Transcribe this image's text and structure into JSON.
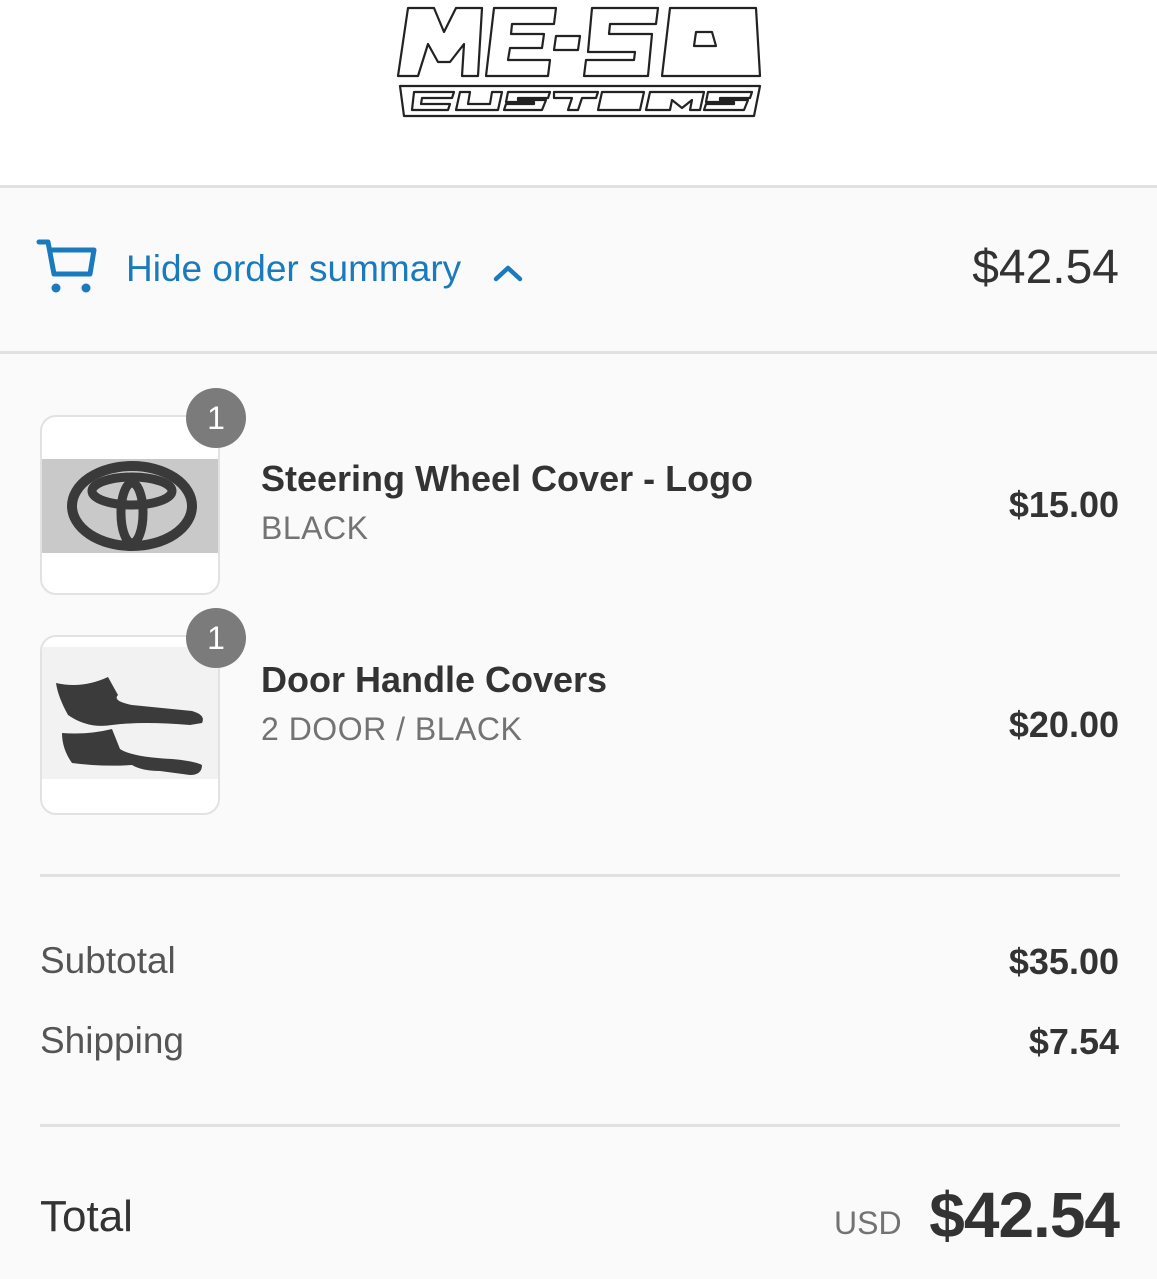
{
  "brand": {
    "logo_text_line1": "ME-SO",
    "logo_text_line2": "CUSTOMS"
  },
  "summary_toggle": {
    "label": "Hide order summary",
    "total": "$42.54",
    "accent_color": "#197bbd"
  },
  "line_items": [
    {
      "quantity": "1",
      "name": "Steering Wheel Cover - Logo",
      "variant": "BLACK",
      "price": "$15.00"
    },
    {
      "quantity": "1",
      "name": "Door Handle Covers",
      "variant": "2 DOOR / BLACK",
      "price": "$20.00"
    }
  ],
  "costs": {
    "subtotal_label": "Subtotal",
    "subtotal_value": "$35.00",
    "shipping_label": "Shipping",
    "shipping_value": "$7.54"
  },
  "total": {
    "label": "Total",
    "currency": "USD",
    "value": "$42.54"
  }
}
